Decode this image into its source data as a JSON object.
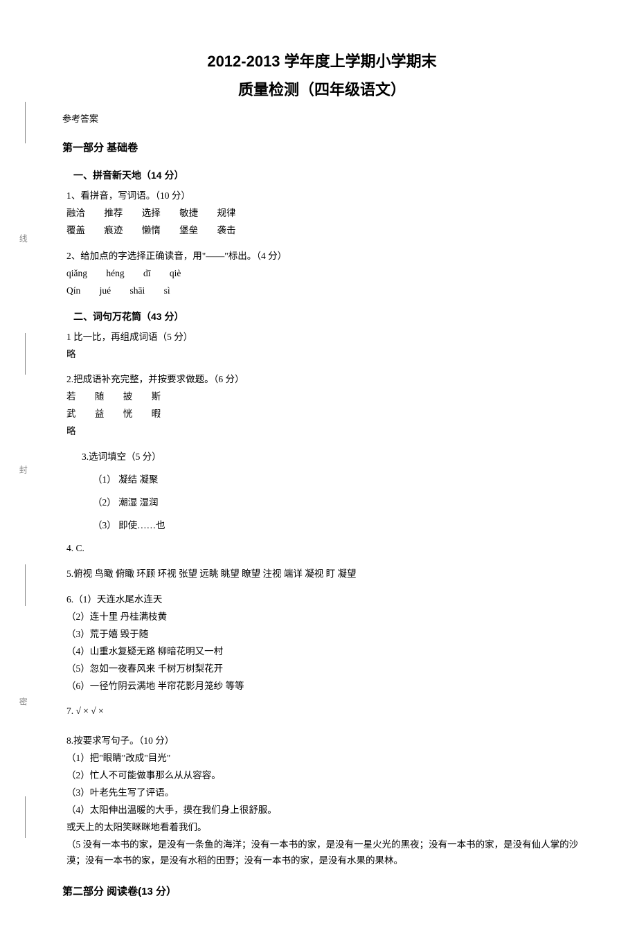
{
  "margin": {
    "c1": "线",
    "c2": "封",
    "c3": "密"
  },
  "title1": "2012-2013 学年度上学期小学期末",
  "title2": "质量检测（四年级语文）",
  "ref": "参考答案",
  "part1": {
    "heading": "第一部分  基础卷",
    "s1": {
      "title": "一、拼音新天地（14 分）",
      "q1": {
        "prompt": "1、看拼音，写词语。（10 分）",
        "row1": {
          "a": "融洽",
          "b": "推荐",
          "c": "选择",
          "d": "敏捷",
          "e": "规律"
        },
        "row2": {
          "a": "覆盖",
          "b": "痕迹",
          "c": "懒惰",
          "d": "堡垒",
          "e": "袭击"
        }
      },
      "q2": {
        "prompt": "2、给加点的字选择正确读音，用\"——\"标出。（4 分）",
        "row1": {
          "a": "qiǎng",
          "b": "héng",
          "c": "dī",
          "d": "qiè"
        },
        "row2": {
          "a": "Qín",
          "b": "jué",
          "c": "shāi",
          "d": "sì"
        }
      }
    },
    "s2": {
      "title": "二、词句万花筒（43 分）",
      "q1": {
        "prompt": "1 比一比，再组成词语（5 分）",
        "ans": "略"
      },
      "q2": {
        "prompt": "2.把成语补充完整，并按要求做题。（6 分）",
        "row1": {
          "a": "若",
          "b": "随",
          "c": "披",
          "d": "斯"
        },
        "row2": {
          "a": "武",
          "b": "益",
          "c": "恍",
          "d": "暇"
        },
        "ans": "略"
      },
      "q3": {
        "prompt": "3.选词填空（5 分）",
        "i1": "（1） 凝结      凝聚",
        "i2": "（2） 潮湿       湿润",
        "i3": "（3）  即使……也"
      },
      "q4": "4.   C.",
      "q5": "5.俯视 鸟瞰 俯瞰      环顾 环视 张望      远眺 眺望 瞭望      注视 端详 凝视 盯 凝望",
      "q6": {
        "prompt": "6.（1）天连水尾水连天",
        "i2": "（2）连十里       丹桂满枝黄",
        "i3": "（3）荒于嬉      毁于随",
        "i4": "（4）山重水复疑无路   柳暗花明又一村",
        "i5": "（5）忽如一夜春风来   千树万树梨花开",
        "i6": "（6）一径竹阴云满地  半帘花影月笼纱  等等"
      },
      "q7": "7.   √  ×    √  ×",
      "q8": {
        "prompt": "8.按要求写句子。（10 分）",
        "i1": "（1）把\"眼睛\"改成\"目光\"",
        "i2": "（2）忙人不可能做事那么从从容容。",
        "i3": "（3）叶老先生写了评语。",
        "i4": "（4）太阳伸出温暖的大手，摸在我们身上很舒服。",
        "alt": "或天上的太阳笑眯眯地看着我们。",
        "i5": "（5 没有一本书的家，是没有一条鱼的海洋；没有一本书的家，是没有一星火光的黑夜；没有一本书的家，是没有仙人掌的沙漠；没有一本书的家，是没有水稻的田野；没有一本书的家，是没有水果的果林。"
      }
    }
  },
  "part2": {
    "heading": "第二部分  阅读卷(13 分）"
  }
}
